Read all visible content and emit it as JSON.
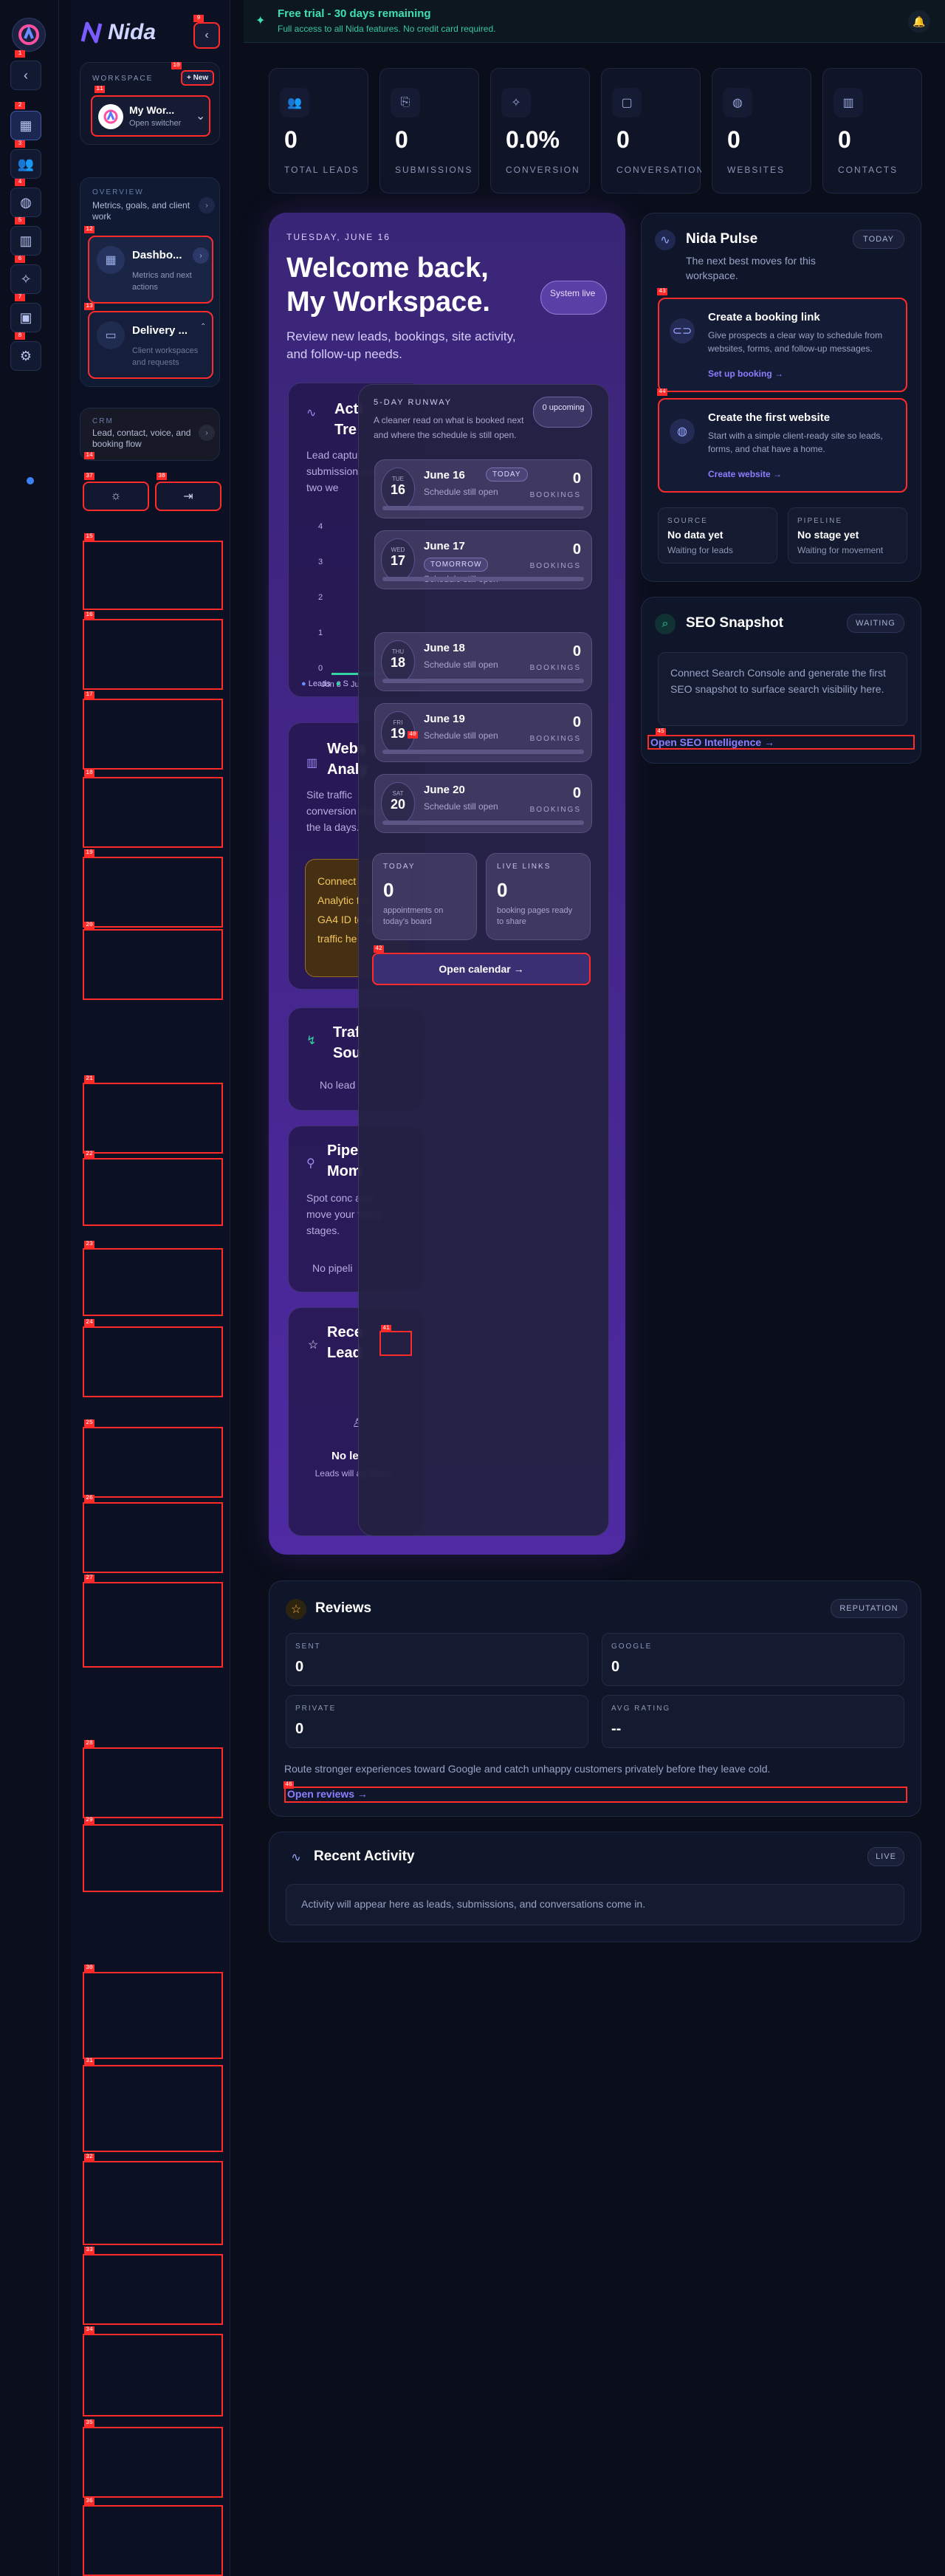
{
  "app": {
    "name": "Nida"
  },
  "banner": {
    "title": "Free trial - 30 days remaining",
    "subtitle": "Full access to all Nida features. No credit card required."
  },
  "sidebar": {
    "workspace_label": "WORKSPACE",
    "new_label": "+ New",
    "workspace_name": "My Wor...",
    "workspace_sub": "Open switcher",
    "overview_label": "OVERVIEW",
    "overview_desc": "Metrics, goals, and client work",
    "dashboard_title": "Dashbo...",
    "dashboard_desc": "Metrics and next actions",
    "delivery_title": "Delivery ...",
    "delivery_desc": "Client workspaces and requests",
    "crm_label": "CRM",
    "crm_desc": "Lead, contact, voice, and booking flow"
  },
  "stats": [
    {
      "icon": "users-icon",
      "value": "0",
      "label": "TOTAL LEADS"
    },
    {
      "icon": "file-icon",
      "value": "0",
      "label": "SUBMISSIONS"
    },
    {
      "icon": "sparkle-icon",
      "value": "0.0%",
      "label": "CONVERSION"
    },
    {
      "icon": "chat-icon",
      "value": "0",
      "label": "CONVERSATIONS"
    },
    {
      "icon": "globe-icon",
      "value": "0",
      "label": "WEBSITES"
    },
    {
      "icon": "bar-chart-icon",
      "value": "0",
      "label": "CONTACTS"
    }
  ],
  "hero": {
    "date": "TUESDAY, JUNE 16",
    "title_line1": "Welcome back,",
    "title_line2": "My Workspace.",
    "status": "System live",
    "subtitle": "Review new leads, bookings, site activity, and follow-up needs."
  },
  "activity": {
    "title_a": "Acti",
    "title_b": "Tre",
    "desc": "Lead captu submission last two we",
    "y_ticks": [
      "4",
      "3",
      "2",
      "1",
      "0"
    ],
    "x_ticks": [
      "Jun 3",
      "Ju"
    ],
    "legend": [
      "Leads",
      "S"
    ]
  },
  "website": {
    "title_a": "Webs",
    "title_b": "Analy",
    "desc": "Site traffic conversion from the la days.",
    "notice": "Connect Analytic the GA4 ID to sta traffic he"
  },
  "traffic": {
    "title_a": "Traf",
    "title_b": "Sou",
    "empty": "No lead"
  },
  "pipeline": {
    "title_a": "Pipe",
    "title_b": "Mom",
    "desc": "Spot conc and move your first p stages.",
    "empty": "No pipeli"
  },
  "recent_leads": {
    "title_a": "Rece",
    "title_b": "Lead",
    "empty": "No le",
    "empty_sub": "Leads will ap they c"
  },
  "runway": {
    "label": "5-DAY RUNWAY",
    "desc": "A cleaner read on what is booked next and where the schedule is still open.",
    "upcoming": "0 upcoming",
    "days": [
      {
        "dow": "TUE",
        "num": "16",
        "title": "June 16",
        "tag": "TODAY",
        "sub": "Schedule still open",
        "count": "0",
        "unit": "BOOKINGS"
      },
      {
        "dow": "WED",
        "num": "17",
        "title": "June 17",
        "tag": "TOMORROW",
        "sub": "Schedule still open",
        "count": "0",
        "unit": "BOOKINGS"
      },
      {
        "dow": "THU",
        "num": "18",
        "title": "June 18",
        "tag": "",
        "sub": "Schedule still open",
        "count": "0",
        "unit": "BOOKINGS"
      },
      {
        "dow": "FRI",
        "num": "19",
        "title": "June 19",
        "tag": "",
        "sub": "Schedule still open",
        "count": "0",
        "unit": "BOOKINGS"
      },
      {
        "dow": "SAT",
        "num": "20",
        "title": "June 20",
        "tag": "",
        "sub": "Schedule still open",
        "count": "0",
        "unit": "BOOKINGS"
      }
    ],
    "today_label": "TODAY",
    "today_value": "0",
    "today_desc": "appointments on today's board",
    "links_label": "LIVE LINKS",
    "links_value": "0",
    "links_desc": "booking pages ready to share",
    "open_calendar": "Open calendar →"
  },
  "pulse": {
    "title": "Nida Pulse",
    "badge": "TODAY",
    "desc": "The next best moves for this workspace.",
    "items": [
      {
        "title": "Create a booking link",
        "desc": "Give prospects a clear way to schedule from websites, forms, and follow-up messages.",
        "link": "Set up booking →"
      },
      {
        "title": "Create the first website",
        "desc": "Start with a simple client-ready site so leads, forms, and chat have a home.",
        "link": "Create website →"
      }
    ],
    "source_label": "SOURCE",
    "source_value": "No data yet",
    "source_sub": "Waiting for leads",
    "pipeline_label": "PIPELINE",
    "pipeline_value": "No stage yet",
    "pipeline_sub": "Waiting for movement"
  },
  "seo": {
    "title": "SEO Snapshot",
    "badge": "WAITING",
    "desc": "Connect Search Console and generate the first SEO snapshot to surface search visibility here.",
    "link": "Open SEO Intelligence →"
  },
  "reviews": {
    "title": "Reviews",
    "badge": "REPUTATION",
    "sent_label": "SENT",
    "sent_value": "0",
    "google_label": "GOOGLE",
    "google_value": "0",
    "private_label": "PRIVATE",
    "private_value": "0",
    "avg_label": "AVG RATING",
    "avg_value": "--",
    "desc": "Route stronger experiences toward Google and catch unhappy customers privately before they leave cold.",
    "link": "Open reviews →"
  },
  "recent_activity": {
    "title": "Recent Activity",
    "badge": "LIVE",
    "empty": "Activity will appear here as leads, submissions, and conversations come in."
  },
  "annotations": [
    "1",
    "2",
    "3",
    "4",
    "5",
    "6",
    "7",
    "8",
    "9",
    "10",
    "11",
    "12",
    "13",
    "14",
    "15",
    "16",
    "17",
    "18",
    "19",
    "20",
    "21",
    "22",
    "23",
    "24",
    "25",
    "26",
    "27",
    "28",
    "29",
    "30",
    "31",
    "32",
    "33",
    "34",
    "35",
    "36",
    "37",
    "38",
    "40",
    "41",
    "42",
    "43",
    "44",
    "45",
    "46"
  ]
}
